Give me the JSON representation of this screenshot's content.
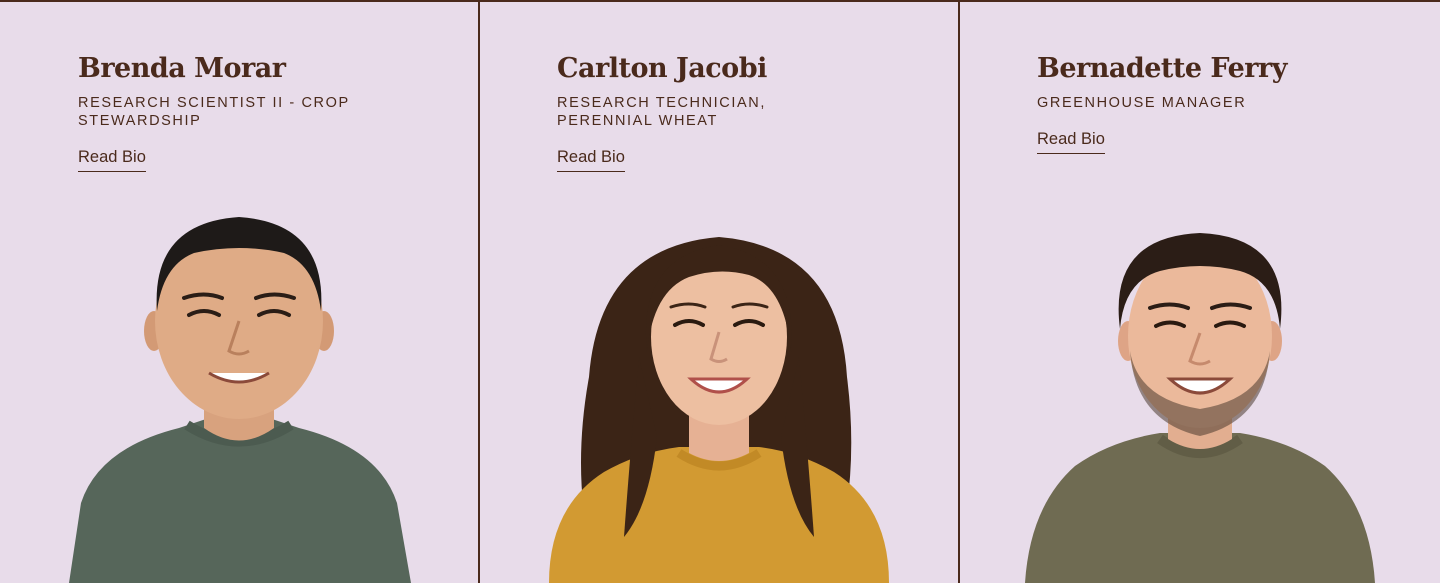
{
  "team": {
    "members": [
      {
        "name": "Brenda Morar",
        "role": "Research Scientist II - Crop Stewardship",
        "link_label": "Read Bio",
        "sweater_color": "#56665a"
      },
      {
        "name": "Carlton Jacobi",
        "role": "Research Technician, Perennial Wheat",
        "link_label": "Read Bio",
        "sweater_color": "#d29a32"
      },
      {
        "name": "Bernadette Ferry",
        "role": "Greenhouse Manager",
        "link_label": "Read Bio",
        "sweater_color": "#6f6b52"
      }
    ]
  },
  "colors": {
    "background": "#e8dcea",
    "text": "#4a2a1c",
    "divider": "#4a2a1c"
  }
}
